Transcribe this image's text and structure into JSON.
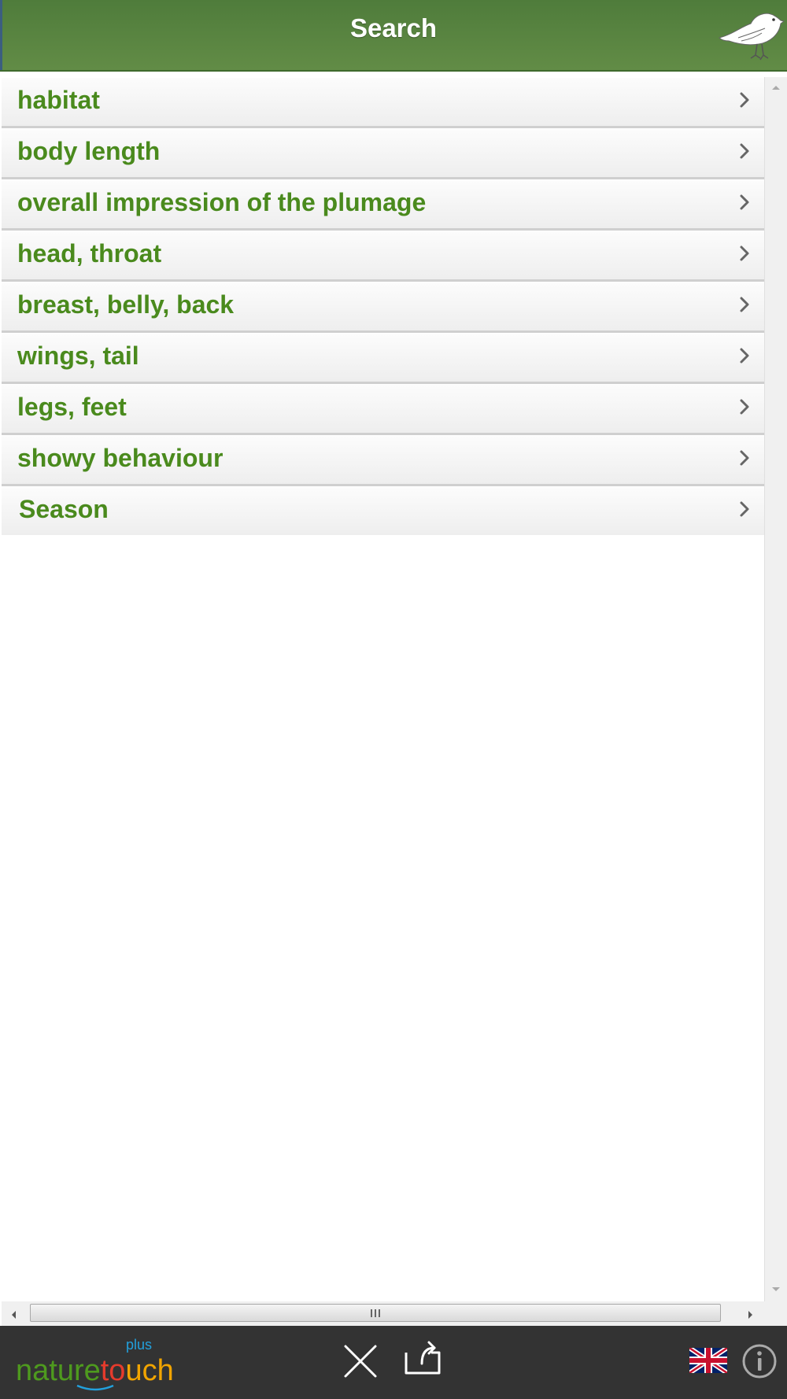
{
  "header": {
    "title": "Search"
  },
  "criteria": [
    {
      "label": "habitat"
    },
    {
      "label": "body length"
    },
    {
      "label": "overall impression of the plumage"
    },
    {
      "label": "head, throat"
    },
    {
      "label": "breast, belly, back"
    },
    {
      "label": "wings, tail"
    },
    {
      "label": "legs, feet"
    },
    {
      "label": "showy behaviour"
    },
    {
      "label": "Season"
    }
  ],
  "footer": {
    "logo": {
      "nature": "nature",
      "touch_part1": "to",
      "touch_part2": "uch",
      "plus": "plus"
    },
    "icons": {
      "close": "close-icon",
      "share": "share-icon",
      "language": "uk-flag-icon",
      "info": "info-icon"
    }
  },
  "colors": {
    "header_green": "#5a8541",
    "label_green": "#4a8a1d",
    "footer_bg": "#333333",
    "logo_green": "#4e9a1e",
    "logo_red": "#e53b2c",
    "logo_orange": "#f1a400",
    "logo_blue": "#22a0dc"
  }
}
